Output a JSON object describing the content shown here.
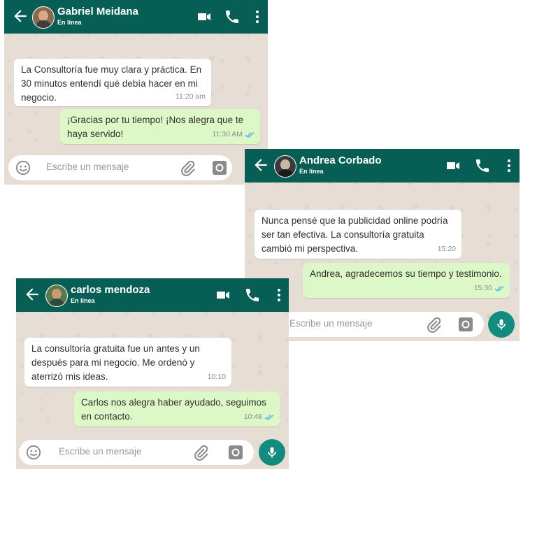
{
  "colors": {
    "header": "#075e54",
    "incoming": "#ffffff",
    "outgoing": "#dcf8c6",
    "mic": "#128c7e",
    "ticks": "#4fb6ec"
  },
  "chats": [
    {
      "contact": "Gabriel Meidana",
      "status": "En línea",
      "incoming": {
        "text": "La Consultoría fue muy clara y práctica. En 30 minutos entendí qué debía hacer en mi negocio.",
        "time": "11:20 am"
      },
      "outgoing": {
        "text": "¡Gracias por tu tiempo! ¡Nos alegra que te haya servido!",
        "time": "11:30 AM"
      },
      "placeholder": "Escribe un mensaje"
    },
    {
      "contact": "Andrea Corbado",
      "status": "En línea",
      "incoming": {
        "text": "Nunca pensé que la publicidad online podría ser tan efectiva. La consultoría gratuita cambió mi perspectiva.",
        "time": "15:20"
      },
      "outgoing": {
        "text": "Andrea, agradecemos su tiempo y testimonio.",
        "time": "15:30"
      },
      "placeholder": "Escribe un mensaje"
    },
    {
      "contact": "carlos mendoza",
      "status": "En línea",
      "incoming": {
        "text": "La consultoría gratuita fue un antes y un después para mi negocio. Me ordenó y aterrizó mis ideas.",
        "time": "10:10"
      },
      "outgoing": {
        "text": "Carlos nos alegra haber ayudado, seguimos en contacto.",
        "time": "10:48"
      },
      "placeholder": "Escribe un mensaje"
    }
  ]
}
